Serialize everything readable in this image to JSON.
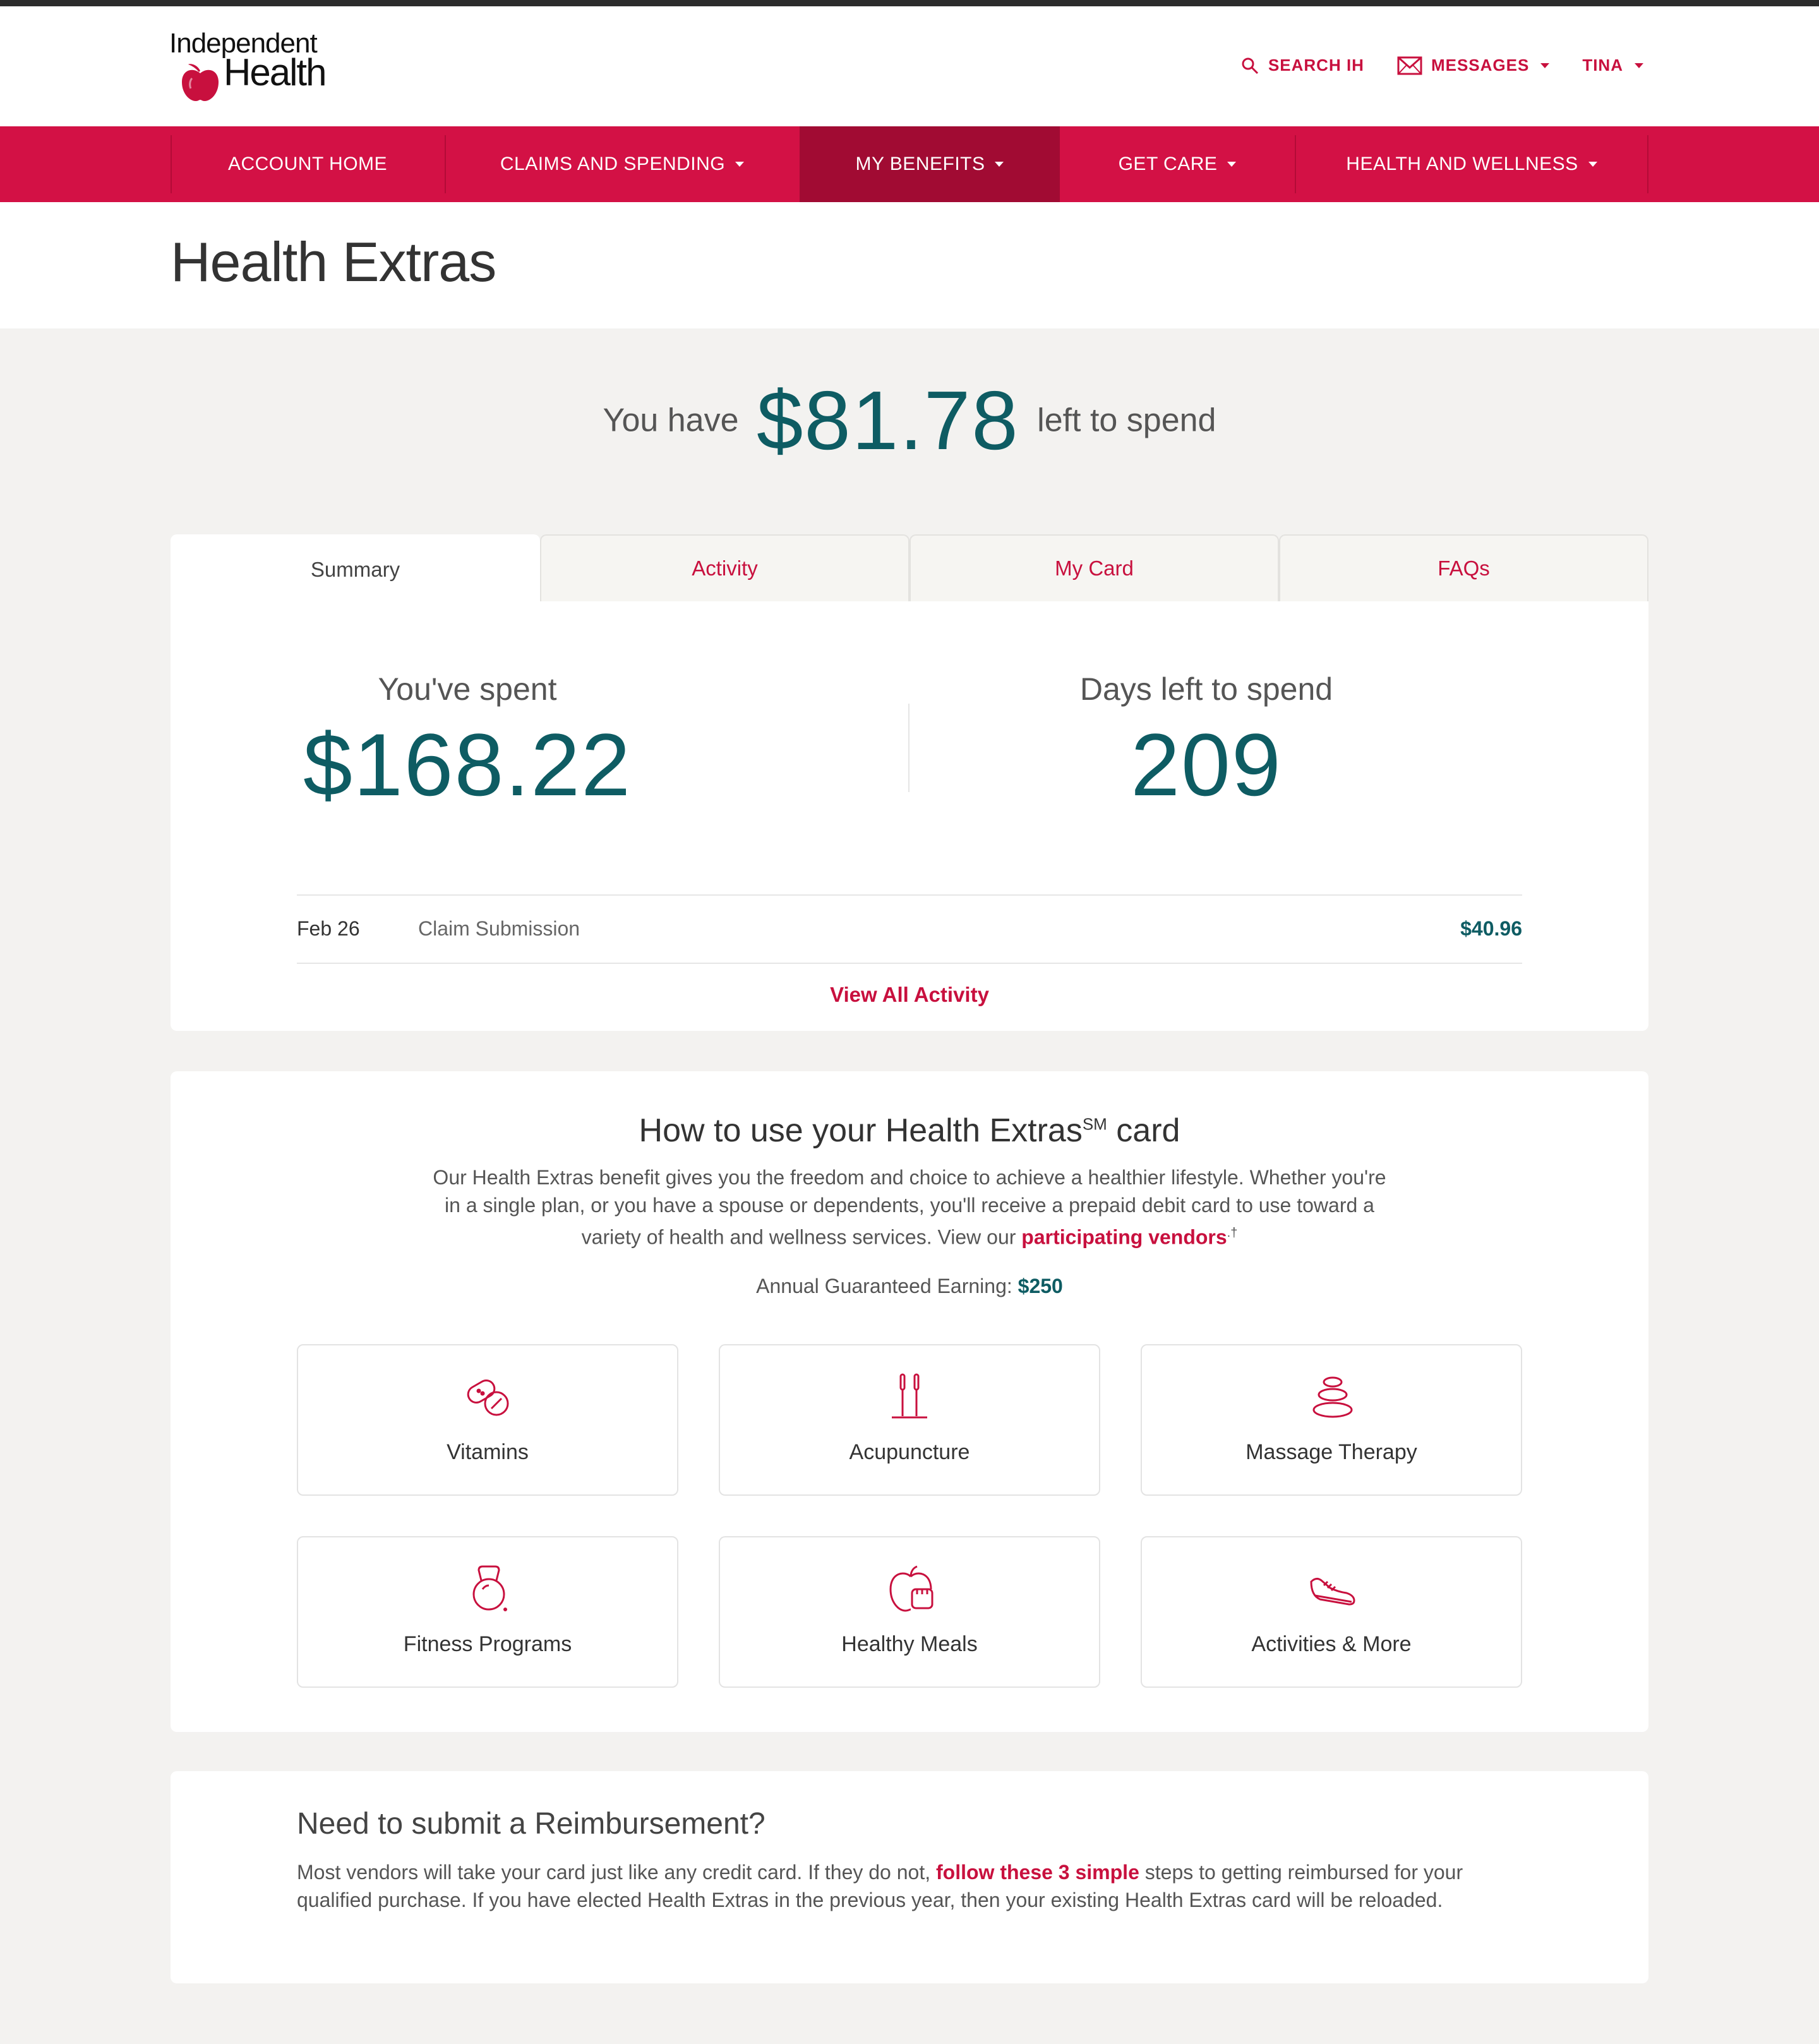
{
  "brand": {
    "logo_line1": "Independent",
    "logo_line2": "Health",
    "accent": "#d31145",
    "accent_dark": "#a10b33",
    "teal": "#0e5c63"
  },
  "utility": [
    {
      "label": "SEARCH IH",
      "icon": "search-icon"
    },
    {
      "label": "MESSAGES",
      "icon": "envelope-icon"
    },
    {
      "label": "TINA"
    }
  ],
  "nav": [
    {
      "label": "ACCOUNT HOME"
    },
    {
      "label": "CLAIMS AND SPENDING"
    },
    {
      "label": "MY BENEFITS"
    },
    {
      "label": "GET CARE"
    },
    {
      "label": "HEALTH AND WELLNESS"
    }
  ],
  "page_title": "Health Extras",
  "balance": {
    "prefix": "You have",
    "amount": "$81.78",
    "suffix": "left to spend"
  },
  "tabs": [
    "Summary",
    "Activity",
    "My Card",
    "FAQs"
  ],
  "summary": {
    "spent_label": "You've spent",
    "spent_value": "$168.22",
    "days_label": "Days left to spend",
    "days_value": "209",
    "activity": {
      "date": "Feb 26",
      "description": "Claim Submission",
      "amount": "$40.96"
    },
    "view_all": "View All Activity"
  },
  "howto": {
    "title": "How to use your Health Extras",
    "title_mark": "SM",
    "title_end": "card",
    "text": "Our Health Extras benefit gives you the freedom and choice to achieve a healthier lifestyle. Whether you're in a single plan, or you have a spouse or dependents, you'll receive a prepaid debit card to use toward a variety of health and wellness services. View our",
    "link": "participating vendors",
    "footnote": ".†",
    "earning_label": "Annual Guaranteed Earning:",
    "earning_value": "$250",
    "tiles": [
      {
        "label": "Vitamins",
        "icon": "vitamins-icon"
      },
      {
        "label": "Acupuncture",
        "icon": "acupuncture-icon"
      },
      {
        "label": "Massage Therapy",
        "icon": "massage-stones-icon"
      },
      {
        "label": "Fitness Programs",
        "icon": "kettlebell-icon"
      },
      {
        "label": "Healthy Meals",
        "icon": "apple-icon"
      },
      {
        "label": "Activities & More",
        "icon": "sneaker-icon"
      }
    ]
  },
  "reimbursement": {
    "title": "Need to submit a Reimbursement?",
    "text_before": "Most vendors will take your card just like any credit card. If they do not,",
    "link": "follow these 3 simple",
    "text_after": "steps to getting reimbursed for your qualified purchase. If you have elected Health Extras in the previous year, then your existing Health Extras card will be reloaded."
  }
}
